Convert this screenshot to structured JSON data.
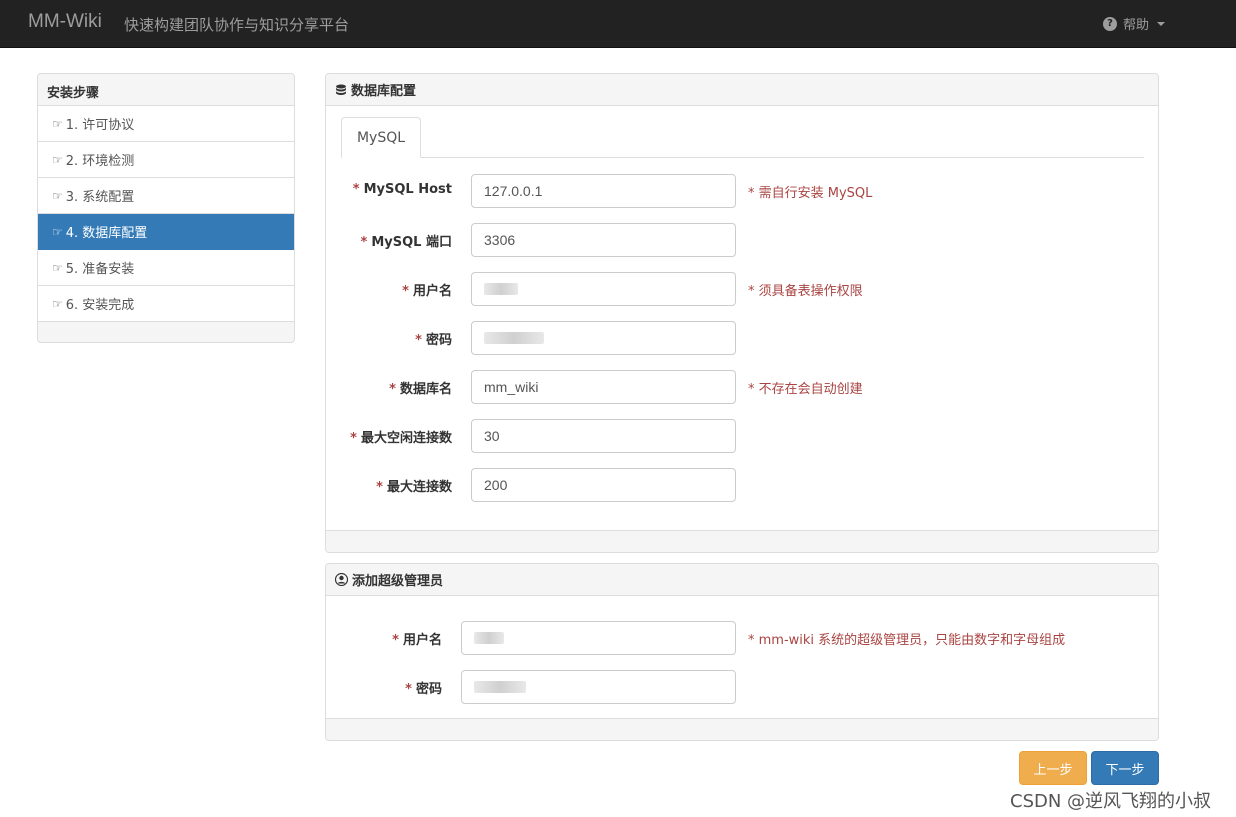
{
  "navbar": {
    "brand": "MM-Wiki",
    "slogan": "快速构建团队协作与知识分享平台",
    "help_label": "帮助"
  },
  "sidebar": {
    "title": "安装步骤",
    "items": [
      {
        "label": "1. 许可协议"
      },
      {
        "label": "2. 环境检测"
      },
      {
        "label": "3. 系统配置"
      },
      {
        "label": "4. 数据库配置"
      },
      {
        "label": "5. 准备安装"
      },
      {
        "label": "6. 安装完成"
      }
    ],
    "active_index": 3
  },
  "db_panel": {
    "title": "数据库配置",
    "tab": "MySQL",
    "fields": [
      {
        "label": "MySQL Host",
        "value": "127.0.0.1",
        "hint": "* 需自行安装 MySQL"
      },
      {
        "label": "MySQL 端口",
        "value": "3306",
        "hint": ""
      },
      {
        "label": "用户名",
        "value": "",
        "hint": "* 须具备表操作权限"
      },
      {
        "label": "密码",
        "value": "",
        "hint": ""
      },
      {
        "label": "数据库名",
        "value": "mm_wiki",
        "hint": "* 不存在会自动创建"
      },
      {
        "label": "最大空闲连接数",
        "value": "30",
        "hint": ""
      },
      {
        "label": "最大连接数",
        "value": "200",
        "hint": ""
      }
    ]
  },
  "admin_panel": {
    "title": "添加超级管理员",
    "fields": [
      {
        "label": "用户名",
        "value": "",
        "hint": "* mm-wiki 系统的超级管理员，只能由数字和字母组成"
      },
      {
        "label": "密码",
        "value": "",
        "hint": ""
      }
    ]
  },
  "buttons": {
    "prev": "上一步",
    "next": "下一步"
  },
  "watermark": "CSDN @逆风飞翔的小叔",
  "colors": {
    "navbar_bg": "#222222",
    "active_blue": "#337ab7",
    "warning_orange": "#f0ad4e",
    "hint_red": "#a94442"
  }
}
